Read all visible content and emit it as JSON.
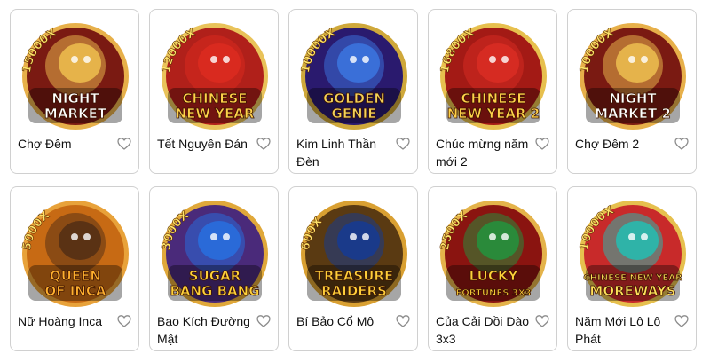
{
  "games": [
    {
      "title": "Chợ Đêm",
      "multiplier": "15000X",
      "logo_lines": [
        "NIGHT",
        "MARKET"
      ],
      "bg": "#7a1a12",
      "ring": "#e7b04a",
      "logo_color": "#ffffff",
      "accent": "#e6b34a",
      "icon": "heart-outline-icon"
    },
    {
      "title": "Tết Nguyên Đán",
      "multiplier": "12000X",
      "logo_lines": [
        "CHINESE",
        "NEW YEAR"
      ],
      "bg": "#b0201a",
      "ring": "#e9c35a",
      "logo_color": "#ffd24a",
      "accent": "#d92a1f",
      "icon": "heart-outline-icon"
    },
    {
      "title": "Kim Linh Thần Đèn",
      "multiplier": "10000X",
      "logo_lines": [
        "GOLDEN",
        "GENIE"
      ],
      "bg": "#2a1a6e",
      "ring": "#cfa83a",
      "logo_color": "#f3d25a",
      "accent": "#3a6fd8",
      "icon": "heart-outline-icon"
    },
    {
      "title": "Chúc mừng năm mới 2",
      "multiplier": "16800X",
      "logo_lines": [
        "CHINESE",
        "NEW YEAR 2"
      ],
      "bg": "#a31a15",
      "ring": "#e7c04e",
      "logo_color": "#ffd24a",
      "accent": "#d62b22",
      "icon": "heart-outline-icon"
    },
    {
      "title": "Chợ Đêm 2",
      "multiplier": "10000X",
      "logo_lines": [
        "NIGHT",
        "MARKET 2"
      ],
      "bg": "#7a1a12",
      "ring": "#e7b04a",
      "logo_color": "#ffffff",
      "accent": "#e5b34b",
      "icon": "heart-outline-icon"
    },
    {
      "title": "Nữ Hoàng Inca",
      "multiplier": "5000X",
      "logo_lines": [
        "QUEEN",
        "OF INCA"
      ],
      "bg": "#c76a14",
      "ring": "#e8a23a",
      "logo_color": "#ffb02e",
      "accent": "#5a3214",
      "icon": "heart-outline-icon"
    },
    {
      "title": "Bạo Kích Đường Mật",
      "multiplier": "3000X",
      "logo_lines": [
        "SUGAR",
        "BANG BANG"
      ],
      "bg": "#4a2a7a",
      "ring": "#e0a83a",
      "logo_color": "#ffd23a",
      "accent": "#2a6ad8",
      "icon": "heart-outline-icon"
    },
    {
      "title": "Bí Bảo Cổ Mộ",
      "multiplier": "600X",
      "logo_lines": [
        "TREASURE",
        "RAIDERS"
      ],
      "bg": "#5a3a12",
      "ring": "#d9a032",
      "logo_color": "#ffcf3a",
      "accent": "#1a3a8a",
      "icon": "heart-outline-icon"
    },
    {
      "title": "Của Cải Dồi Dào 3x3",
      "multiplier": "2500X",
      "logo_lines": [
        "LUCKY",
        "FORTUNES 3X3"
      ],
      "bg": "#8a1410",
      "ring": "#e4b34a",
      "logo_color": "#ffd23a",
      "accent": "#2a8a3a",
      "icon": "heart-outline-icon"
    },
    {
      "title": "Năm Mới Lộ Lộ Phát",
      "multiplier": "10000X",
      "logo_lines": [
        "CHINESE NEW YEAR",
        "MOREWAYS"
      ],
      "bg": "#c82a2a",
      "ring": "#e6c04e",
      "logo_color": "#ffe15a",
      "accent": "#2fb3a8",
      "icon": "heart-outline-icon"
    }
  ]
}
